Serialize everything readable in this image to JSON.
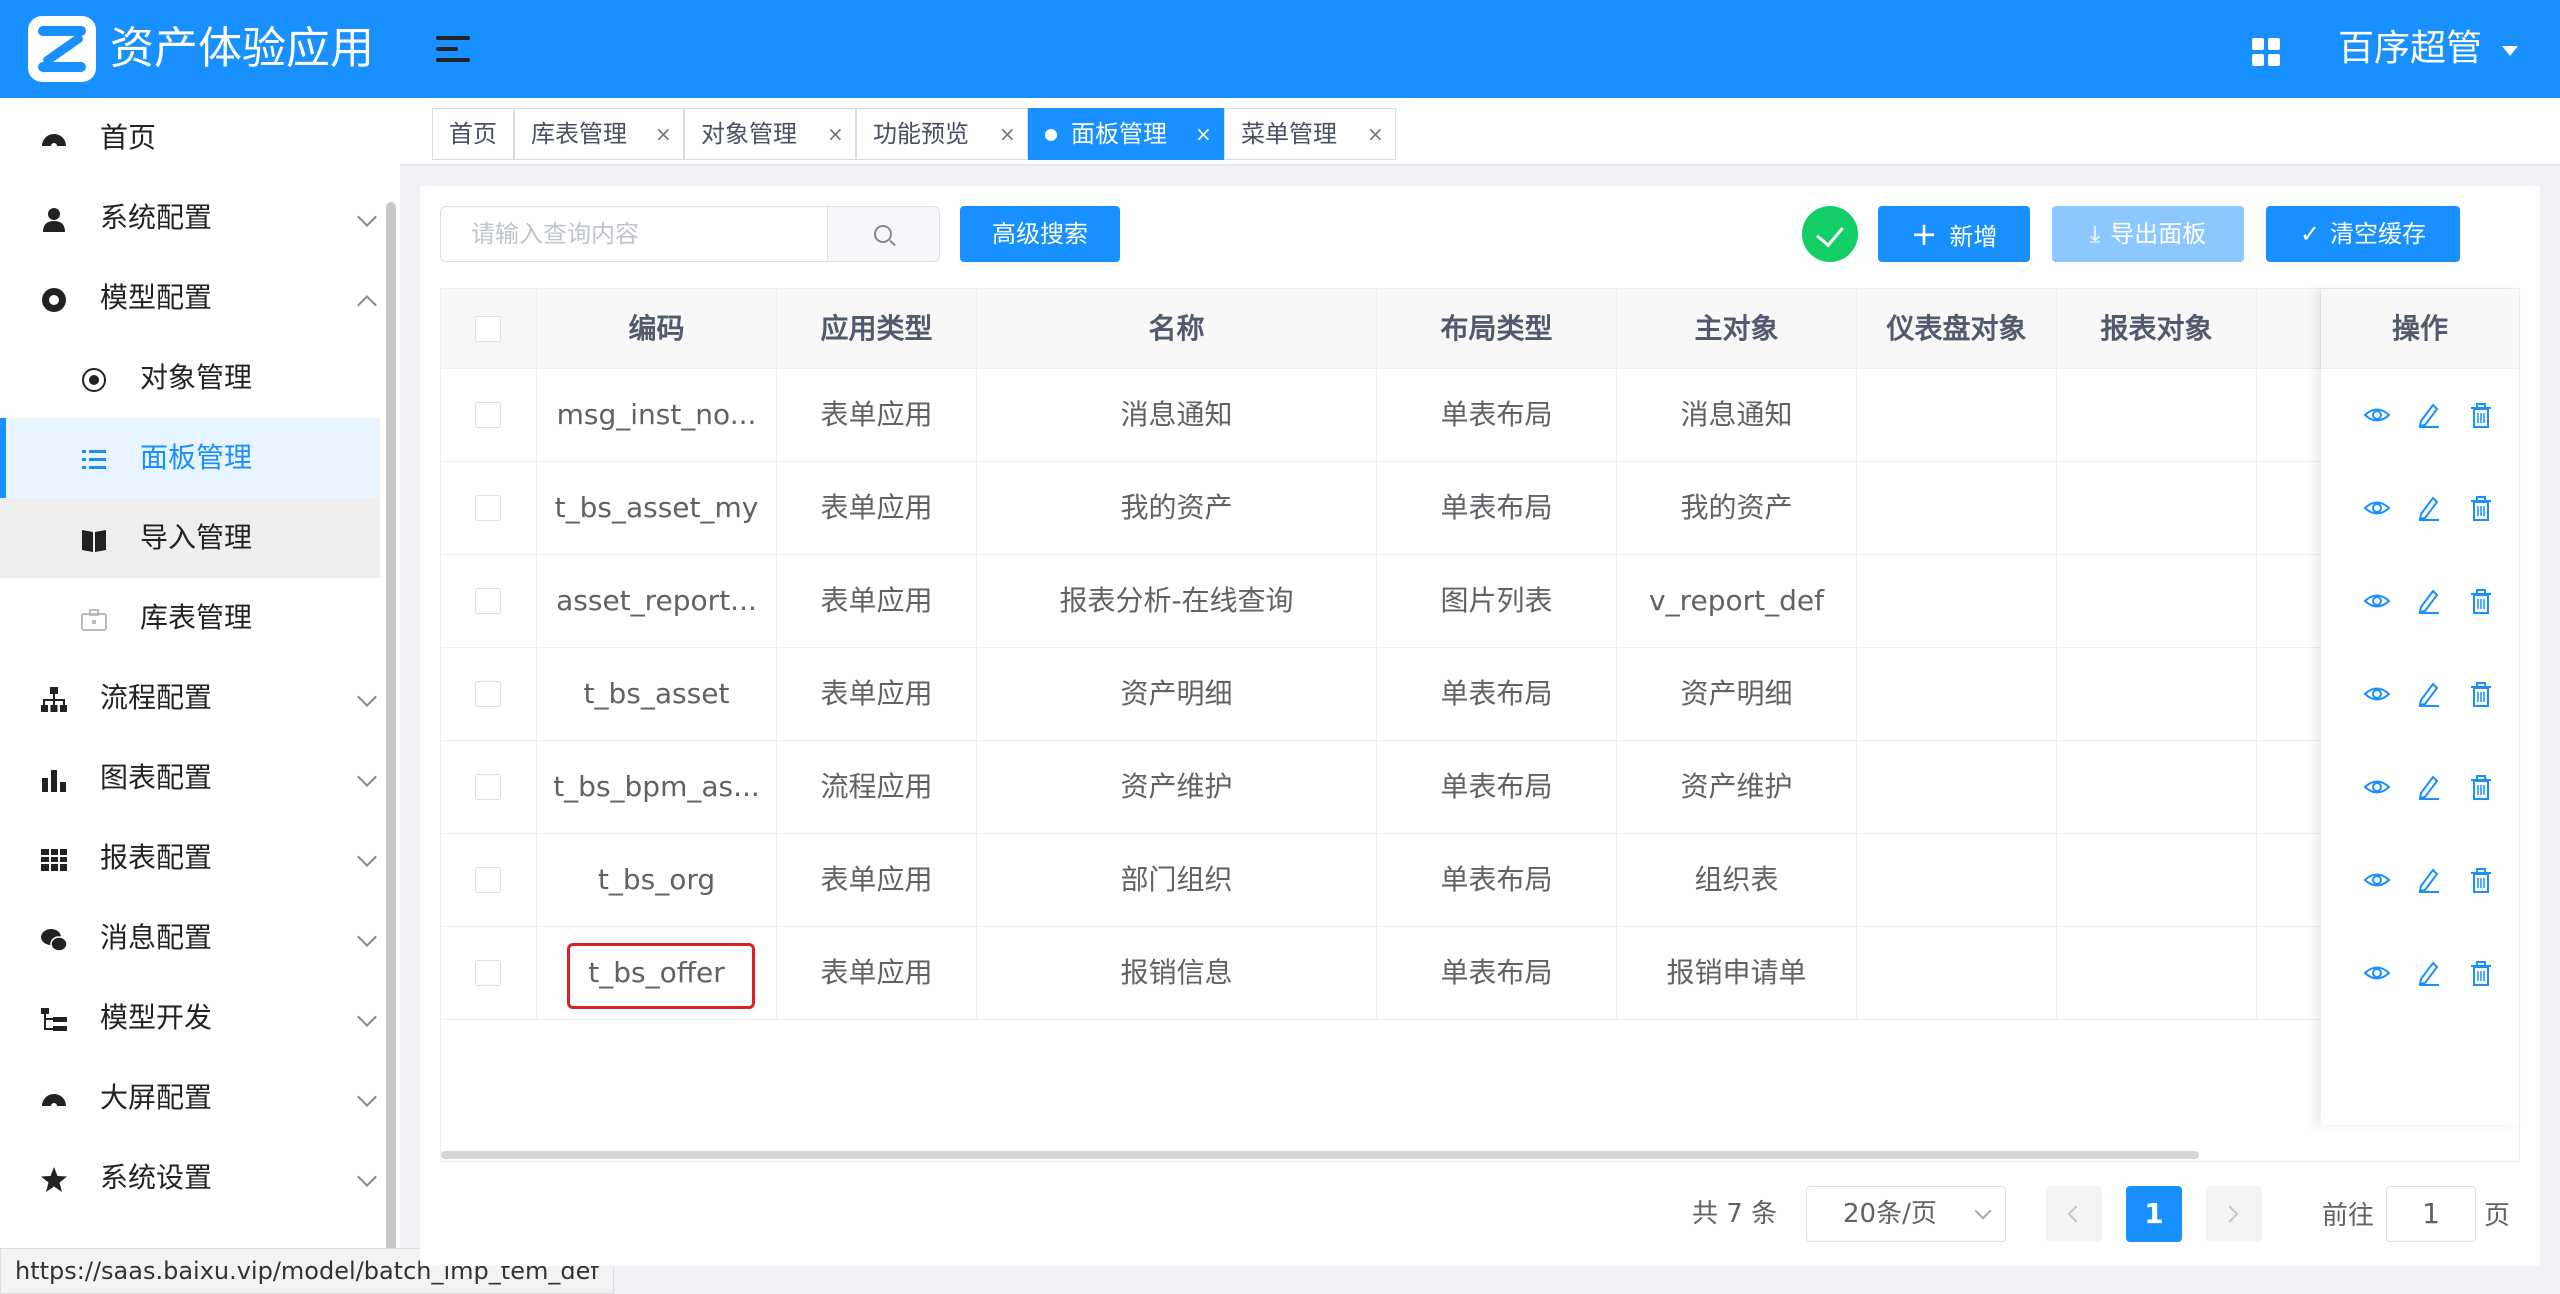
{
  "header": {
    "app_title": "资产体验应用",
    "user_name": "百序超管",
    "brand_color": "#1890ff"
  },
  "sidebar": {
    "items": [
      {
        "label": "首页",
        "icon": "dashboard-icon"
      },
      {
        "label": "系统配置",
        "icon": "user-icon"
      },
      {
        "label": "模型配置",
        "icon": "model-icon"
      },
      {
        "label": "对象管理",
        "icon": "radio-icon"
      },
      {
        "label": "面板管理",
        "icon": "list-icon"
      },
      {
        "label": "导入管理",
        "icon": "book-icon"
      },
      {
        "label": "库表管理",
        "icon": "database-icon"
      },
      {
        "label": "流程配置",
        "icon": "sitemap-icon"
      },
      {
        "label": "图表配置",
        "icon": "bar-chart-icon"
      },
      {
        "label": "报表配置",
        "icon": "table-icon"
      },
      {
        "label": "消息配置",
        "icon": "wechat-icon"
      },
      {
        "label": "模型开发",
        "icon": "tree-icon"
      },
      {
        "label": "大屏配置",
        "icon": "dashboard-icon"
      },
      {
        "label": "系统设置",
        "icon": "star-icon"
      }
    ]
  },
  "url_tip": "https://saas.baixu.vip/model/batch_imp_tem_def",
  "tabs": [
    {
      "label": "首页"
    },
    {
      "label": "库表管理"
    },
    {
      "label": "对象管理"
    },
    {
      "label": "功能预览"
    },
    {
      "label": "面板管理"
    },
    {
      "label": "菜单管理"
    }
  ],
  "toolbar": {
    "search_placeholder": "请输入查询内容",
    "advanced_search": "高级搜索",
    "add": "新增",
    "export": "导出面板",
    "clear_cache": "清空缓存"
  },
  "table": {
    "columns": [
      "编码",
      "应用类型",
      "名称",
      "布局类型",
      "主对象",
      "仪表盘对象",
      "报表对象",
      "操作"
    ],
    "rows": [
      [
        "msg_inst_no...",
        "表单应用",
        "消息通知",
        "单表布局",
        "消息通知",
        "",
        ""
      ],
      [
        "t_bs_asset_my",
        "表单应用",
        "我的资产",
        "单表布局",
        "我的资产",
        "",
        ""
      ],
      [
        "asset_report...",
        "表单应用",
        "报表分析-在线查询",
        "图片列表",
        "v_report_def",
        "",
        ""
      ],
      [
        "t_bs_asset",
        "表单应用",
        "资产明细",
        "单表布局",
        "资产明细",
        "",
        ""
      ],
      [
        "t_bs_bpm_as...",
        "流程应用",
        "资产维护",
        "单表布局",
        "资产维护",
        "",
        ""
      ],
      [
        "t_bs_org",
        "表单应用",
        "部门组织",
        "单表布局",
        "组织表",
        "",
        ""
      ],
      [
        "t_bs_offer",
        "表单应用",
        "报销信息",
        "单表布局",
        "报销申请单",
        "",
        ""
      ]
    ]
  },
  "pagination": {
    "total": "共 7 条",
    "page_size": "20条/页",
    "current_page": "1",
    "goto_label": "前往",
    "goto_value": "1",
    "goto_unit": "页"
  }
}
